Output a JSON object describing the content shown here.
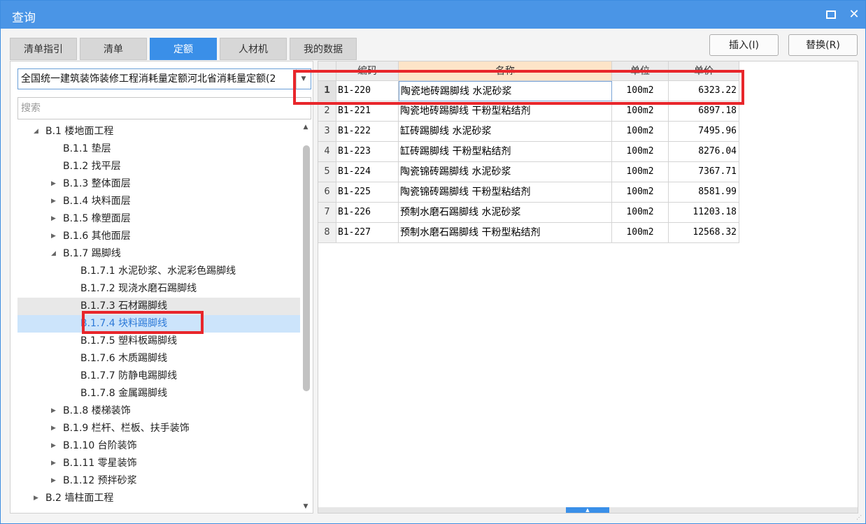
{
  "window": {
    "title": "查询",
    "maximize_icon": "maximize-icon",
    "close_icon": "close-icon",
    "close_glyph": "✕"
  },
  "tabs": [
    {
      "label": "清单指引",
      "active": false
    },
    {
      "label": "清单",
      "active": false
    },
    {
      "label": "定额",
      "active": true
    },
    {
      "label": "人材机",
      "active": false
    },
    {
      "label": "我的数据",
      "active": false
    }
  ],
  "buttons": {
    "insert": "插入(I)",
    "replace": "替换(R)"
  },
  "library_select": {
    "value": "全国统一建筑装饰装修工程消耗量定额河北省消耗量定额(2"
  },
  "search": {
    "placeholder": "搜索"
  },
  "tree": [
    {
      "label": "B.1 楼地面工程",
      "level": 0,
      "toggle": "expanded"
    },
    {
      "label": "B.1.1 垫层",
      "level": 1,
      "toggle": "none"
    },
    {
      "label": "B.1.2 找平层",
      "level": 1,
      "toggle": "none"
    },
    {
      "label": "B.1.3 整体面层",
      "level": 1,
      "toggle": "collapsed"
    },
    {
      "label": "B.1.4 块料面层",
      "level": 1,
      "toggle": "collapsed"
    },
    {
      "label": "B.1.5 橡塑面层",
      "level": 1,
      "toggle": "collapsed"
    },
    {
      "label": "B.1.6 其他面层",
      "level": 1,
      "toggle": "collapsed"
    },
    {
      "label": "B.1.7 踢脚线",
      "level": 1,
      "toggle": "expanded"
    },
    {
      "label": "B.1.7.1 水泥砂浆、水泥彩色踢脚线",
      "level": 2,
      "toggle": "none"
    },
    {
      "label": "B.1.7.2 现浇水磨石踢脚线",
      "level": 2,
      "toggle": "none"
    },
    {
      "label": "B.1.7.3 石材踢脚线",
      "level": 2,
      "toggle": "none",
      "state": "hover"
    },
    {
      "label": "B.1.7.4 块料踢脚线",
      "level": 2,
      "toggle": "none",
      "state": "selected"
    },
    {
      "label": "B.1.7.5 塑料板踢脚线",
      "level": 2,
      "toggle": "none"
    },
    {
      "label": "B.1.7.6 木质踢脚线",
      "level": 2,
      "toggle": "none"
    },
    {
      "label": "B.1.7.7 防静电踢脚线",
      "level": 2,
      "toggle": "none"
    },
    {
      "label": "B.1.7.8 金属踢脚线",
      "level": 2,
      "toggle": "none"
    },
    {
      "label": "B.1.8 楼梯装饰",
      "level": 1,
      "toggle": "collapsed"
    },
    {
      "label": "B.1.9 栏杆、栏板、扶手装饰",
      "level": 1,
      "toggle": "collapsed"
    },
    {
      "label": "B.1.10 台阶装饰",
      "level": 1,
      "toggle": "collapsed"
    },
    {
      "label": "B.1.11 零星装饰",
      "level": 1,
      "toggle": "collapsed"
    },
    {
      "label": "B.1.12 预拌砂浆",
      "level": 1,
      "toggle": "collapsed"
    },
    {
      "label": "B.2 墙柱面工程",
      "level": 0,
      "toggle": "collapsed"
    }
  ],
  "table": {
    "columns": [
      "编码",
      "名称",
      "单位",
      "单价"
    ],
    "rows": [
      {
        "no": "1",
        "code": "B1-220",
        "name": "陶瓷地砖踢脚线 水泥砂浆",
        "unit": "100m2",
        "price": "6323.22",
        "selected": true
      },
      {
        "no": "2",
        "code": "B1-221",
        "name": "陶瓷地砖踢脚线 干粉型粘结剂",
        "unit": "100m2",
        "price": "6897.18"
      },
      {
        "no": "3",
        "code": "B1-222",
        "name": "缸砖踢脚线 水泥砂浆",
        "unit": "100m2",
        "price": "7495.96"
      },
      {
        "no": "4",
        "code": "B1-223",
        "name": "缸砖踢脚线 干粉型粘结剂",
        "unit": "100m2",
        "price": "8276.04"
      },
      {
        "no": "5",
        "code": "B1-224",
        "name": "陶瓷锦砖踢脚线 水泥砂浆",
        "unit": "100m2",
        "price": "7367.71"
      },
      {
        "no": "6",
        "code": "B1-225",
        "name": "陶瓷锦砖踢脚线 干粉型粘结剂",
        "unit": "100m2",
        "price": "8581.99"
      },
      {
        "no": "7",
        "code": "B1-226",
        "name": "预制水磨石踢脚线 水泥砂浆",
        "unit": "100m2",
        "price": "11203.18"
      },
      {
        "no": "8",
        "code": "B1-227",
        "name": "预制水磨石踢脚线 干粉型粘结剂",
        "unit": "100m2",
        "price": "12568.32"
      }
    ]
  },
  "highlight_color": "#e8262b",
  "accent_color": "#3a8fe8"
}
